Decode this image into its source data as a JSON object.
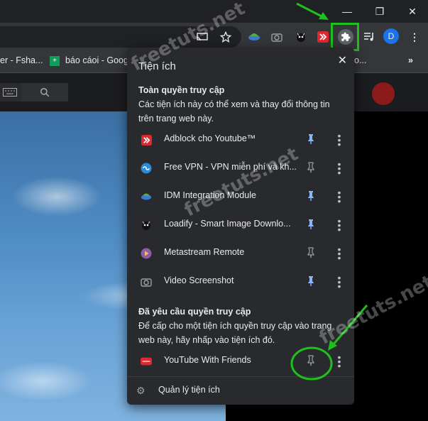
{
  "window": {
    "minimize_glyph": "—",
    "restore_glyph": "❐",
    "close_glyph": "✕"
  },
  "toolbar": {
    "icons": [
      "cast-icon",
      "star-icon",
      "idm-icon",
      "camera-icon",
      "loadify-icon",
      "adblock-icon",
      "puzzle-icon",
      "media-icon",
      "profile-avatar",
      "menu-icon"
    ],
    "profile_letter": "D"
  },
  "bookmarks": {
    "items": [
      {
        "label": "er - Fsha..."
      },
      {
        "label": "báo cáoi - Goog"
      },
      {
        "label": "o..."
      }
    ],
    "more": "»"
  },
  "popup": {
    "title": "Tiện ích",
    "close": "✕",
    "full_access": {
      "heading": "Toàn quyền truy cập",
      "description": "Các tiện ích này có thể xem và thay đổi thông tin trên trang web này."
    },
    "extensions": [
      {
        "name": "Adblock cho Youtube™",
        "icon": "adblock-icon",
        "pinned": true
      },
      {
        "name": "Free VPN - VPN miễn phí và kh...",
        "icon": "vpn-icon",
        "pinned": false
      },
      {
        "name": "IDM Integration Module",
        "icon": "idm-icon",
        "pinned": true
      },
      {
        "name": "Loadify - Smart Image Downlo...",
        "icon": "loadify-icon",
        "pinned": true
      },
      {
        "name": "Metastream Remote",
        "icon": "metastream-icon",
        "pinned": false
      },
      {
        "name": "Video Screenshot",
        "icon": "camera-icon",
        "pinned": true
      }
    ],
    "requested": {
      "heading": "Đã yêu cầu quyền truy cập",
      "description": "Để cấp cho một tiện ích quyền truy cập vào trang web này, hãy nhấp vào tiện ích đó."
    },
    "requested_extensions": [
      {
        "name": "YouTube With Friends",
        "icon": "ytwf-icon",
        "pinned": false
      }
    ],
    "manage_label": "Quản lý tiện ích"
  },
  "watermarks": [
    "freetuts.net",
    "freetuts.net",
    "freetuts.net"
  ],
  "colors": {
    "pinned": "#8ab4f8",
    "unpinned": "#9aa0a6",
    "highlight": "#1ec01e"
  }
}
